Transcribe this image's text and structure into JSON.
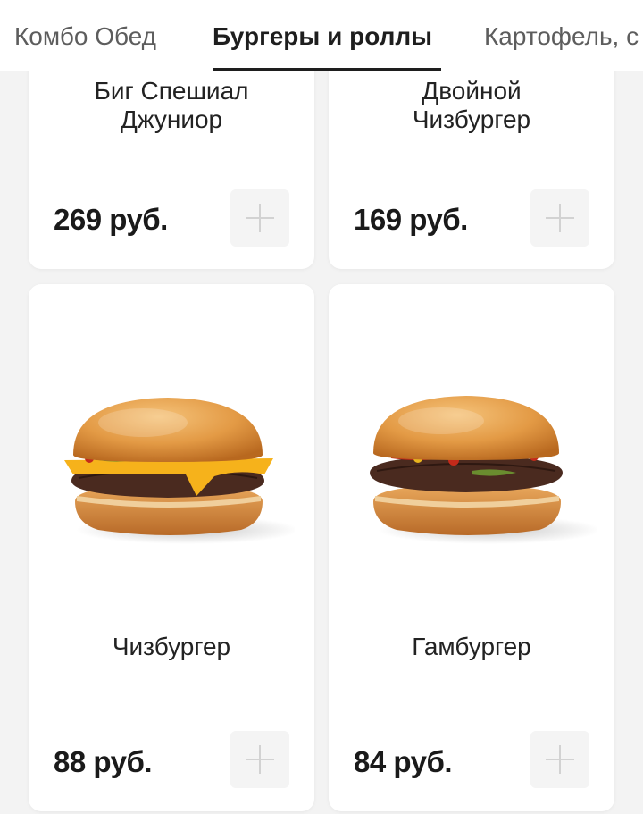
{
  "tabs": [
    {
      "label": "Комбо Обед",
      "active": false
    },
    {
      "label": "Бургеры и роллы",
      "active": true
    },
    {
      "label": "Картофель, с",
      "active": false
    }
  ],
  "products": [
    {
      "name": "Биг Спешиал Джуниор",
      "name_lines": [
        "Биг Спешиал",
        "Джуниор"
      ],
      "price": "269 руб.",
      "image": "burger-icon"
    },
    {
      "name": "Двойной Чизбургер",
      "name_lines": [
        "Двойной",
        "Чизбургер"
      ],
      "price": "169 руб.",
      "image": "burger-icon"
    },
    {
      "name": "Чизбургер",
      "name_lines": [
        "Чизбургер"
      ],
      "price": "88 руб.",
      "image": "cheeseburger-icon"
    },
    {
      "name": "Гамбургер",
      "name_lines": [
        "Гамбургер"
      ],
      "price": "84 руб.",
      "image": "hamburger-icon"
    }
  ],
  "add_icon": "plus-icon",
  "colors": {
    "background": "#f3f3f3",
    "card": "#ffffff",
    "accent_text": "#1e1e1e",
    "bun": "#e39a45",
    "cheese": "#f6b21b",
    "patty": "#4a2a1f"
  }
}
